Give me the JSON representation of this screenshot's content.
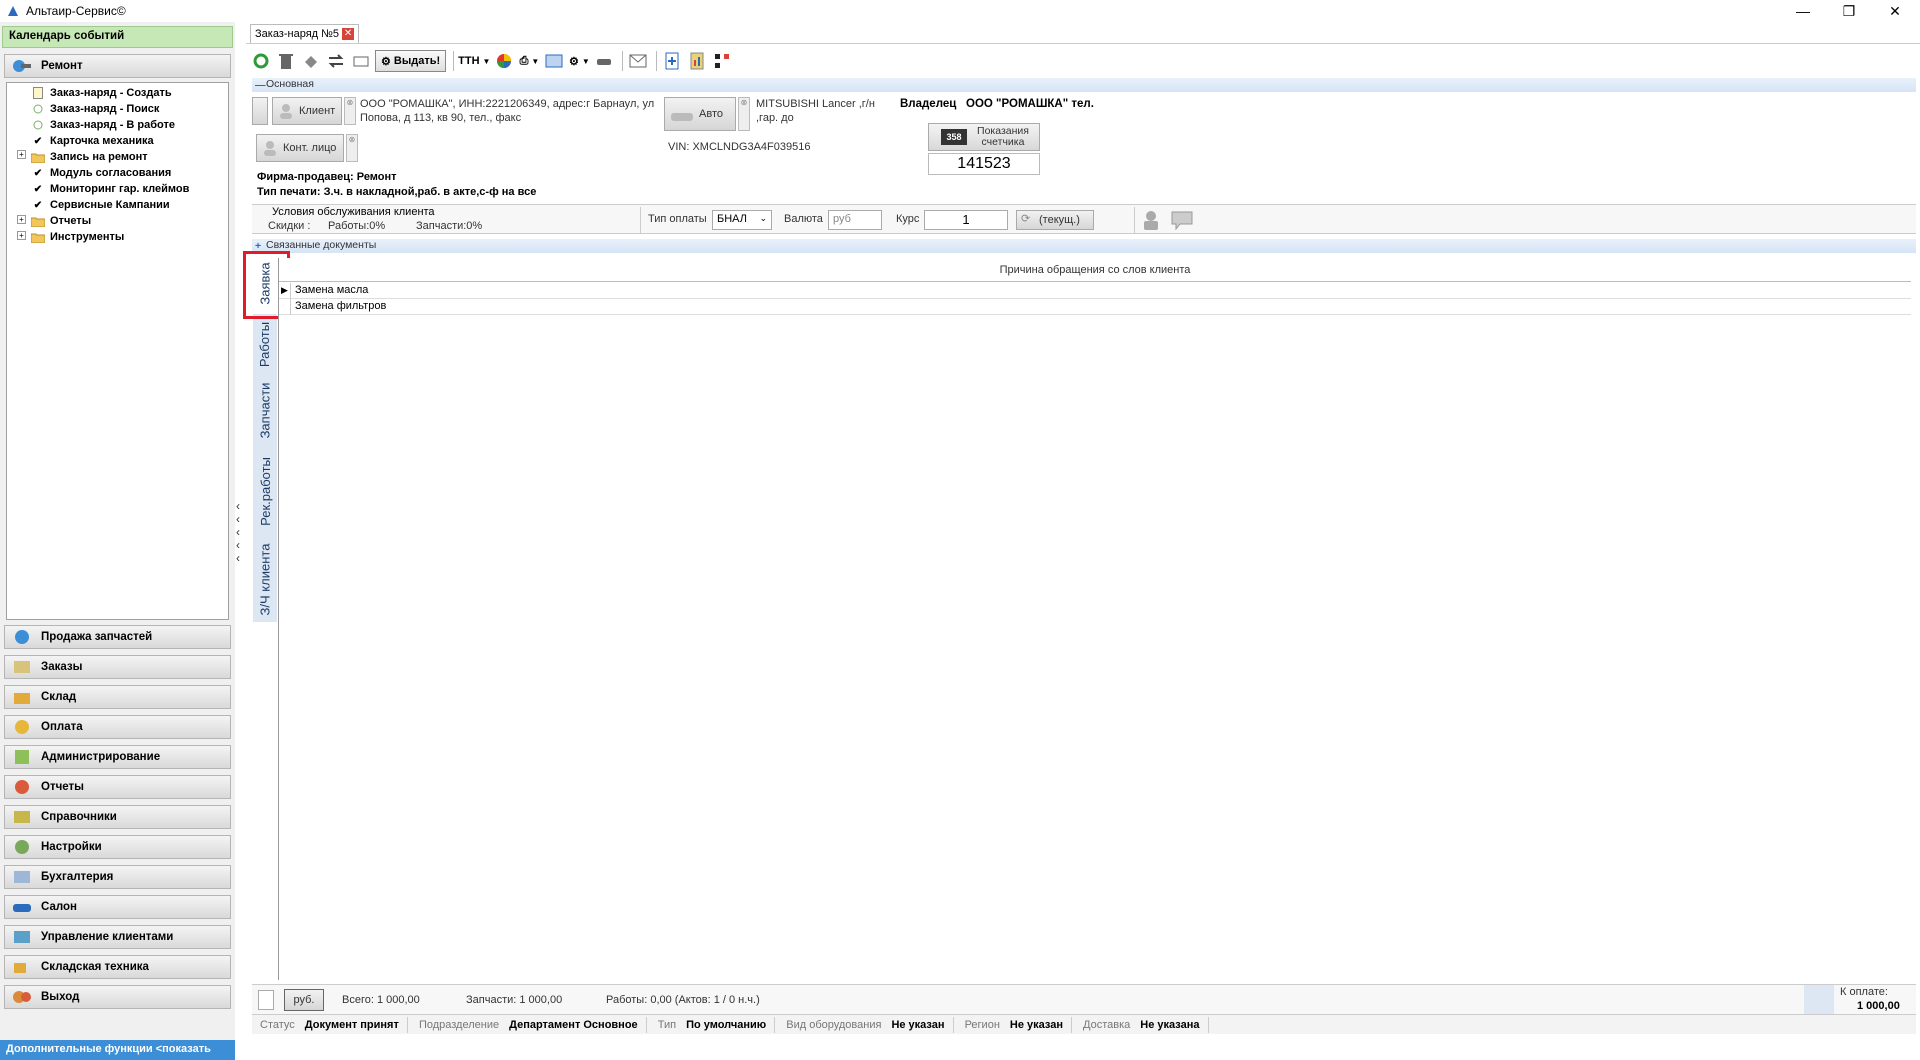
{
  "window": {
    "title": "Альтаир-Сервис©"
  },
  "left_panel": {
    "calendar": "Календарь событий",
    "repair_group": "Ремонт",
    "tree": [
      {
        "label": "Заказ-наряд - Создать",
        "icon": "document-icon"
      },
      {
        "label": "Заказ-наряд - Поиск",
        "icon": "circle-icon"
      },
      {
        "label": "Заказ-наряд - В работе",
        "icon": "circle-icon"
      },
      {
        "label": "Карточка механика",
        "icon": "check-icon"
      },
      {
        "label": "Запись на ремонт",
        "icon": "folder-icon"
      },
      {
        "label": "Модуль согласования",
        "icon": "check-icon"
      },
      {
        "label": "Мониторинг гар. клеймов",
        "icon": "check-icon"
      },
      {
        "label": "Сервисные Кампании",
        "icon": "check-icon"
      },
      {
        "label": "Отчеты",
        "icon": "folder-icon"
      },
      {
        "label": "Инструменты",
        "icon": "folder-icon"
      }
    ],
    "groups": [
      {
        "label": "Продажа запчастей",
        "icon": "parts-icon"
      },
      {
        "label": "Заказы",
        "icon": "orders-icon"
      },
      {
        "label": "Склад",
        "icon": "warehouse-icon"
      },
      {
        "label": "Оплата",
        "icon": "payment-icon"
      },
      {
        "label": "Администрирование",
        "icon": "admin-icon"
      },
      {
        "label": "Отчеты",
        "icon": "reports-icon"
      },
      {
        "label": "Справочники",
        "icon": "reference-icon"
      },
      {
        "label": "Настройки",
        "icon": "settings-icon"
      },
      {
        "label": "Бухгалтерия",
        "icon": "accounting-icon"
      },
      {
        "label": "Салон",
        "icon": "car-icon"
      },
      {
        "label": "Управление клиентами",
        "icon": "clients-icon"
      },
      {
        "label": "Складская техника",
        "icon": "forklift-icon"
      },
      {
        "label": "Выход",
        "icon": "exit-icon"
      }
    ],
    "bottom": "Дополнительные функции <показать"
  },
  "doc_tab": {
    "label": "Заказ-наряд №5"
  },
  "toolbar": {
    "issue_label": "Выдать!",
    "ttn_label": "ТТН"
  },
  "section_main": "Основная",
  "client": {
    "client_btn": "Клиент",
    "client_text": "ООО \"РОМАШКА\", ИНН:2221206349, адрес:г Барнаул, ул Попова, д 113, кв 90, тел., факс",
    "contact_btn": "Конт. лицо",
    "auto_btn": "Авто",
    "auto_text": "MITSUBISHI Lancer ,г/н ,гар. до",
    "vin": "VIN: XMCLNDG3A4F039516",
    "owner_label": "Владелец",
    "owner_value": "ООО \"РОМАШКА\" тел.",
    "counter_label": "Показания счетчика",
    "counter_icon": "358",
    "counter_value": "141523",
    "seller": "Фирма-продавец: Ремонт",
    "print_type": "Тип печати: З.ч. в накладной,раб. в акте,с-ф на все"
  },
  "conditions": {
    "title": "Условия обслуживания клиента",
    "discounts": "Скидки :",
    "works": "Работы:0%",
    "parts": "Запчасти:0%",
    "pay_type_label": "Тип оплаты",
    "pay_type_value": "БНАЛ",
    "currency_label": "Валюта",
    "currency_value": "руб",
    "rate_label": "Курс",
    "rate_value": "1",
    "current_btn": "(текущ.)"
  },
  "section_linked": "Связанные документы",
  "vtabs": [
    "Заявка",
    "Работы",
    "Запчасти",
    "Рек.работы",
    "З/Ч клиента"
  ],
  "grid": {
    "header": "Причина обращения со слов клиента",
    "rows": [
      "Замена масла",
      "Замена фильтров"
    ]
  },
  "totals": {
    "currency": "руб.",
    "total": "Всего: 1 000,00",
    "parts": "Запчасти: 1 000,00",
    "works": "Работы: 0,00 (Актов: 1 / 0 н.ч.)",
    "to_pay_label": "К оплате:",
    "to_pay_value": "1 000,00"
  },
  "status": {
    "status_label": "Статус",
    "status_value": "Документ принят",
    "dept_label": "Подразделение",
    "dept_value": "Департамент Основное",
    "type_label": "Тип",
    "type_value": "По умолчанию",
    "equip_label": "Вид оборудования",
    "equip_value": "Не указан",
    "region_label": "Регион",
    "region_value": "Не указан",
    "delivery_label": "Доставка",
    "delivery_value": "Не указана"
  }
}
